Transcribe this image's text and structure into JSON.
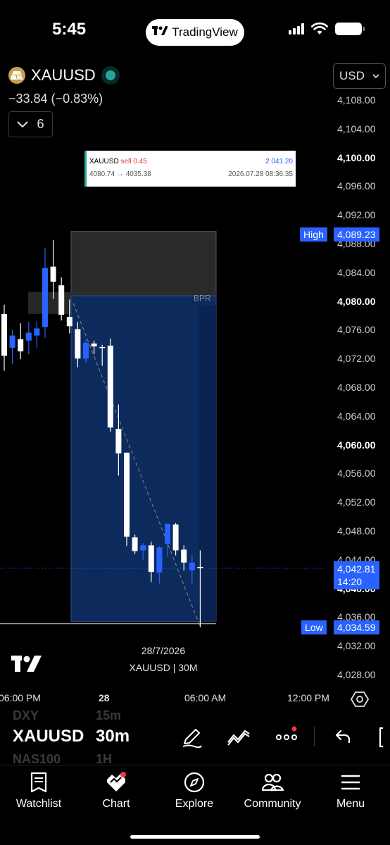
{
  "status_bar": {
    "time": "5:45",
    "app_pill": "TradingView"
  },
  "header": {
    "symbol": "XAUUSD",
    "change": "−33.84 (−0.83%)",
    "indicator_count": "6",
    "currency": "USD"
  },
  "trade": {
    "symbol": "XAUUSD",
    "side": "sell 0.45",
    "pnl": "2 041.20",
    "prices": "4080.74 → 4035.38",
    "datetime": "2026.07.28 08:36:35"
  },
  "price_axis": {
    "ticks": [
      {
        "label": "4,108.00",
        "value": 4108,
        "bold": false
      },
      {
        "label": "4,104.00",
        "value": 4104,
        "bold": false
      },
      {
        "label": "4,100.00",
        "value": 4100,
        "bold": true
      },
      {
        "label": "4,096.00",
        "value": 4096,
        "bold": false
      },
      {
        "label": "4,092.00",
        "value": 4092,
        "bold": false
      },
      {
        "label": "4,088.00",
        "value": 4088,
        "bold": false
      },
      {
        "label": "4,084.00",
        "value": 4084,
        "bold": false
      },
      {
        "label": "4,080.00",
        "value": 4080,
        "bold": true
      },
      {
        "label": "4,076.00",
        "value": 4076,
        "bold": false
      },
      {
        "label": "4,072.00",
        "value": 4072,
        "bold": false
      },
      {
        "label": "4,068.00",
        "value": 4068,
        "bold": false
      },
      {
        "label": "4,064.00",
        "value": 4064,
        "bold": false
      },
      {
        "label": "4,060.00",
        "value": 4060,
        "bold": true
      },
      {
        "label": "4,056.00",
        "value": 4056,
        "bold": false
      },
      {
        "label": "4,052.00",
        "value": 4052,
        "bold": false
      },
      {
        "label": "4,048.00",
        "value": 4048,
        "bold": false
      },
      {
        "label": "4,044.00",
        "value": 4044,
        "bold": false
      },
      {
        "label": "4,040.00",
        "value": 4040,
        "bold": true
      },
      {
        "label": "4,036.00",
        "value": 4036,
        "bold": false
      },
      {
        "label": "4,032.00",
        "value": 4032,
        "bold": false
      },
      {
        "label": "4,028.00",
        "value": 4028,
        "bold": false
      }
    ],
    "high": {
      "tag": "High",
      "value": "4,089.23",
      "level": 4089.23
    },
    "last": {
      "value": "4,042.81",
      "countdown": "14:20",
      "level": 4042.81
    },
    "low": {
      "tag": "Low",
      "value": "4,034.59",
      "level": 4034.59
    }
  },
  "chart": {
    "zone_label": "BPR",
    "date": "28/7/2026",
    "caption": "XAUUSD | 30M",
    "colors": {
      "up": "#ffffff",
      "down": "#2962ff",
      "zone": "#0d2a5c",
      "bpr": "#2a2a2a",
      "accent": "#2962ff"
    }
  },
  "chart_data": {
    "type": "candlestick",
    "series": [
      {
        "o": 4078.2,
        "h": 4079.5,
        "l": 4070.3,
        "c": 4072.4
      },
      {
        "o": 4073.5,
        "h": 4076.0,
        "l": 4071.2,
        "c": 4075.2
      },
      {
        "o": 4074.7,
        "h": 4076.9,
        "l": 4071.9,
        "c": 4073.0
      },
      {
        "o": 4074.5,
        "h": 4077.1,
        "l": 4072.6,
        "c": 4075.6
      },
      {
        "o": 4075.2,
        "h": 4077.2,
        "l": 4073.5,
        "c": 4076.2
      },
      {
        "o": 4076.4,
        "h": 4087.4,
        "l": 4074.9,
        "c": 4084.6
      },
      {
        "o": 4084.8,
        "h": 4088.5,
        "l": 4080.3,
        "c": 4082.7
      },
      {
        "o": 4082.2,
        "h": 4083.3,
        "l": 4077.3,
        "c": 4078.1
      },
      {
        "o": 4077.8,
        "h": 4080.2,
        "l": 4075.5,
        "c": 4076.5
      },
      {
        "o": 4076.1,
        "h": 4077.1,
        "l": 4070.8,
        "c": 4072.0
      },
      {
        "o": 4072.0,
        "h": 4074.7,
        "l": 4071.4,
        "c": 4074.2
      },
      {
        "o": 4074.1,
        "h": 4074.5,
        "l": 4072.6,
        "c": 4073.7
      },
      {
        "o": 4073.6,
        "h": 4073.9,
        "l": 4071.0,
        "c": 4073.5
      },
      {
        "o": 4073.8,
        "h": 4074.8,
        "l": 4061.8,
        "c": 4062.4
      },
      {
        "o": 4062.2,
        "h": 4065.6,
        "l": 4055.7,
        "c": 4058.8
      },
      {
        "o": 4058.9,
        "h": 4058.9,
        "l": 4045.9,
        "c": 4047.2
      },
      {
        "o": 4047.1,
        "h": 4047.5,
        "l": 4044.8,
        "c": 4045.2
      },
      {
        "o": 4045.3,
        "h": 4046.3,
        "l": 4044.0,
        "c": 4046.0
      },
      {
        "o": 4046.0,
        "h": 4046.5,
        "l": 4040.9,
        "c": 4042.3
      },
      {
        "o": 4042.2,
        "h": 4045.9,
        "l": 4040.7,
        "c": 4045.7
      },
      {
        "o": 4046.2,
        "h": 4049.0,
        "l": 4044.4,
        "c": 4049.0
      },
      {
        "o": 4048.9,
        "h": 4049.1,
        "l": 4044.6,
        "c": 4045.3
      },
      {
        "o": 4045.4,
        "h": 4046.0,
        "l": 4042.5,
        "c": 4043.6
      },
      {
        "o": 4042.5,
        "h": 4044.7,
        "l": 4040.6,
        "c": 4043.6
      },
      {
        "o": 4043.0,
        "h": 4045.3,
        "l": 4034.6,
        "c": 4042.8
      }
    ],
    "zones": {
      "bpr": {
        "from": 4080.5,
        "to": 4089.7
      },
      "position": {
        "entry": 4080.74,
        "stop": 4089.7,
        "target": 4035.38
      },
      "bpr_strip": {
        "from": 4078.8,
        "to": 4080.3
      }
    },
    "ylim": [
      4026,
      4110
    ]
  },
  "time_axis": {
    "labels": [
      "06:00 PM",
      "28",
      "06:00 AM",
      "12:00 PM"
    ]
  },
  "toolbar": {
    "symbol": "XAUUSD",
    "interval": "30m",
    "ghost_symbols": [
      "DXY",
      "NAS100"
    ],
    "ghost_intervals": [
      "15m",
      "1H"
    ]
  },
  "nav": {
    "watchlist": "Watchlist",
    "chart": "Chart",
    "explore": "Explore",
    "community": "Community",
    "menu": "Menu"
  }
}
